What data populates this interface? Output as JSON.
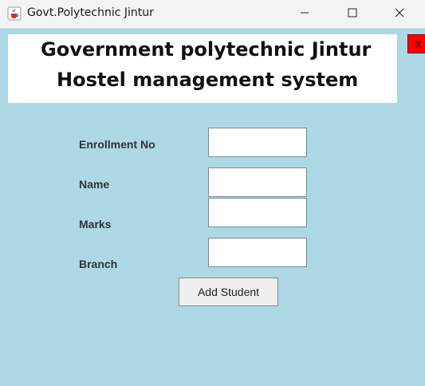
{
  "window": {
    "title": "Govt.Polytechnic Jintur",
    "icons": {
      "app": "java-cup-icon",
      "minimize": "minimize-icon",
      "maximize": "maximize-icon",
      "close": "close-icon"
    }
  },
  "header": {
    "line1": "Government polytechnic Jintur",
    "line2": "Hostel management system"
  },
  "exit_button": {
    "label": "X",
    "color": "#ff0000"
  },
  "form": {
    "fields": [
      {
        "label": "Enrollment No",
        "value": ""
      },
      {
        "label": "Name",
        "value": ""
      },
      {
        "label": "Marks",
        "value": ""
      },
      {
        "label": "Branch",
        "value": ""
      }
    ],
    "submit_label": "Add Student"
  },
  "colors": {
    "background": "#add8e6",
    "header_background": "#ffffff",
    "titlebar": "#f3f3f3"
  }
}
